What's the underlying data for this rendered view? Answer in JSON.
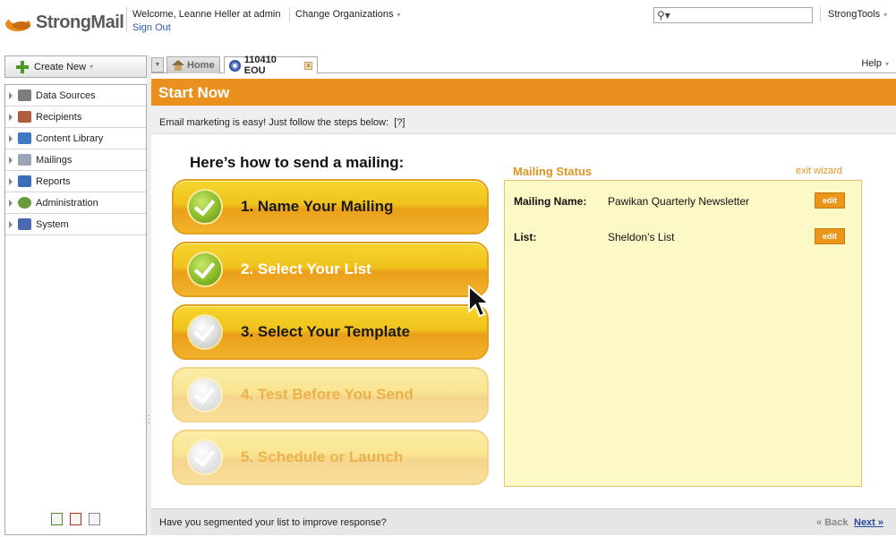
{
  "header": {
    "logo_text": "StrongMail",
    "welcome": "Welcome, Leanne Heller at admin",
    "sign_out": "Sign Out",
    "change_org": "Change Organizations",
    "search_placeholder": "",
    "strongtools": "StrongTools"
  },
  "sidebar": {
    "create_new": "Create New",
    "items": [
      {
        "label": "Data Sources",
        "icon": "database-icon",
        "color": "#7d7d7d"
      },
      {
        "label": "Recipients",
        "icon": "recipients-icon",
        "color": "#b05d3c"
      },
      {
        "label": "Content Library",
        "icon": "content-library-icon",
        "color": "#3f78c4"
      },
      {
        "label": "Mailings",
        "icon": "envelope-icon",
        "color": "#9aa6b8"
      },
      {
        "label": "Reports",
        "icon": "reports-icon",
        "color": "#3a6fb8"
      },
      {
        "label": "Administration",
        "icon": "admin-gear-icon",
        "color": "#6a9a3a"
      },
      {
        "label": "System",
        "icon": "system-icon",
        "color": "#4a6ab0"
      }
    ]
  },
  "tabs": {
    "home": "Home",
    "active": "110410 EOU",
    "help": "Help"
  },
  "main": {
    "title": "Start Now",
    "intro": "Email marketing is easy! Just follow the steps below:",
    "intro_hint": "[?]",
    "steps_title": "Here’s how to send a mailing:",
    "steps": [
      {
        "label": "1. Name Your Mailing",
        "state": "done-current"
      },
      {
        "label": "2. Select Your List",
        "state": "done"
      },
      {
        "label": "3. Select Your Template",
        "state": "next"
      },
      {
        "label": "4. Test Before You Send",
        "state": "disabled"
      },
      {
        "label": "5. Schedule or Launch",
        "state": "disabled"
      }
    ],
    "status": {
      "title": "Mailing Status",
      "exit": "exit wizard",
      "rows": [
        {
          "label": "Mailing Name:",
          "value": "Pawikan Quarterly Newsletter",
          "button": "edit"
        },
        {
          "label": "List:",
          "value": "Sheldon’s List",
          "button": "edit"
        }
      ]
    },
    "footer": {
      "question": "Have you segmented your list to improve response?",
      "back": "« Back",
      "next": "Next »"
    }
  },
  "colors": {
    "accent_orange": "#e9901f",
    "status_bg": "#fdf9c6",
    "link_blue": "#2a5db0"
  }
}
